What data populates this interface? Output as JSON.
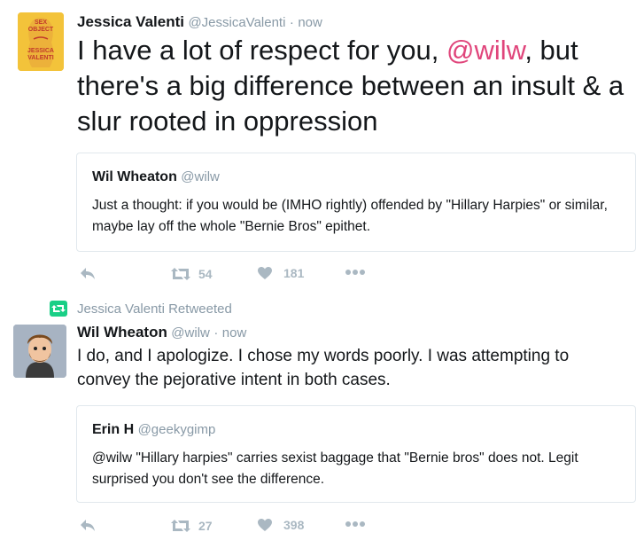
{
  "tweet1": {
    "avatar_title": "SEX OBJECT",
    "avatar_author": "JESSICA VALENTI",
    "name": "Jessica Valenti",
    "handle": "@JessicaValenti",
    "sep": "·",
    "time": "now",
    "text_before": "I have a lot of respect for you, ",
    "mention": "@wilw",
    "text_after": ", but there's a big difference between an insult & a slur rooted in oppression",
    "quote": {
      "name": "Wil Wheaton",
      "handle": "@wilw",
      "text": "Just a thought: if you would be (IMHO rightly) offended by \"Hillary Harpies\" or similar, maybe lay off the whole \"Bernie Bros\" epithet."
    },
    "retweets": "54",
    "likes": "181",
    "colors": {
      "mention": "#e0457b",
      "avatar_bg": "#f3c33a",
      "avatar_text": "#c23a2b"
    }
  },
  "retweet_notice": {
    "label": "Jessica Valenti Retweeted",
    "icon": "retweet-icon",
    "color": "#19cf86"
  },
  "tweet2": {
    "name": "Wil Wheaton",
    "handle": "@wilw",
    "sep": "·",
    "time": "now",
    "text": "I do, and I apologize. I chose my words poorly. I was attempting to convey the pejorative intent in both cases.",
    "quote": {
      "name": "Erin H",
      "handle": "@geekygimp",
      "text": "@wilw \"Hillary harpies\" carries sexist baggage that \"Bernie bros\" does not. Legit surprised you don't see the difference."
    },
    "retweets": "27",
    "likes": "398"
  },
  "icons": {
    "reply": "reply-icon",
    "retweet": "retweet-icon",
    "like": "heart-icon",
    "more": "more-icon"
  }
}
